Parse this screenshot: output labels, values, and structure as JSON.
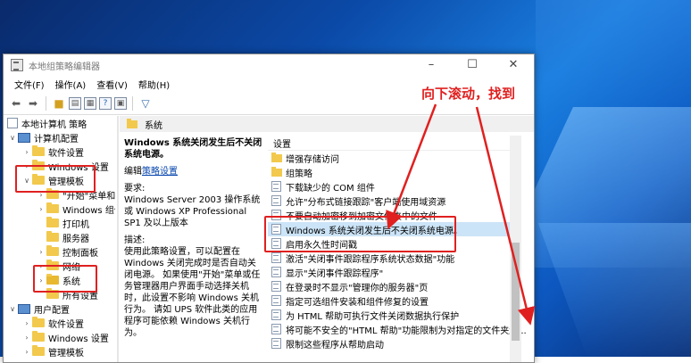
{
  "window": {
    "title": "本地组策略编辑器",
    "controls": [
      "–",
      "☐",
      "✕"
    ]
  },
  "menu": [
    "文件(F)",
    "操作(A)",
    "查看(V)",
    "帮助(H)"
  ],
  "tree": [
    {
      "label": "本地计算机 策略",
      "icon": "policy-icon"
    },
    {
      "label": "计算机配置",
      "icon": "computer-icon"
    },
    {
      "label": "软件设置",
      "icon": "folder-icon"
    },
    {
      "label": "Windows 设置",
      "icon": "folder-icon"
    },
    {
      "label": "管理模板",
      "icon": "folder-icon"
    },
    {
      "label": "\"开始\"菜单和",
      "icon": "folder-icon"
    },
    {
      "label": "Windows 组件",
      "icon": "folder-icon"
    },
    {
      "label": "打印机",
      "icon": "folder-icon"
    },
    {
      "label": "服务器",
      "icon": "folder-icon"
    },
    {
      "label": "控制面板",
      "icon": "folder-icon"
    },
    {
      "label": "网络",
      "icon": "folder-icon"
    },
    {
      "label": "系统",
      "icon": "folder-icon"
    },
    {
      "label": "所有设置",
      "icon": "folder-icon"
    },
    {
      "label": "用户配置",
      "icon": "computer-icon"
    },
    {
      "label": "软件设置",
      "icon": "folder-icon"
    },
    {
      "label": "Windows 设置",
      "icon": "folder-icon"
    },
    {
      "label": "管理模板",
      "icon": "folder-icon"
    }
  ],
  "header": {
    "title": "系统"
  },
  "description": {
    "title": "Windows 系统关闭发生后不关闭系统电源。",
    "edit_prefix": "编辑",
    "edit_link": "策略设置",
    "requirements_label": "要求:",
    "requirements_text": "Windows Server 2003 操作系统或 Windows XP Professional SP1 及以上版本",
    "desc_label": "描述:",
    "desc_text": "使用此策略设置，可以配置在 Windows 关闭完成时是否自动关闭电源。 如果使用\"开始\"菜单或任务管理器用户界面手动选择关机时，此设置不影响 Windows 关机行为。 请如 UPS 软件此类的应用程序可能依赖 Windows 关机行为。"
  },
  "list": {
    "column_header": "设置",
    "rows": [
      {
        "label": "增强存储访问",
        "type": "folder"
      },
      {
        "label": "组策略",
        "type": "folder"
      },
      {
        "label": "下载缺少的 COM 组件",
        "type": "setting"
      },
      {
        "label": "允许\"分布式链接跟踪\"客户端使用域资源",
        "type": "setting"
      },
      {
        "label": "不要自动加密移到加密文件夹中的文件",
        "type": "setting"
      },
      {
        "label": "Windows 系统关闭发生后不关闭系统电源。",
        "type": "setting"
      },
      {
        "label": "启用永久性时间戳",
        "type": "setting"
      },
      {
        "label": "激活\"关闭事件跟踪程序系统状态数据\"功能",
        "type": "setting"
      },
      {
        "label": "显示\"关闭事件跟踪程序\"",
        "type": "setting"
      },
      {
        "label": "在登录时不显示\"管理你的服务器\"页",
        "type": "setting"
      },
      {
        "label": "指定可选组件安装和组件修复的设置",
        "type": "setting"
      },
      {
        "label": "为 HTML 帮助可执行文件关闭数据执行保护",
        "type": "setting"
      },
      {
        "label": "将可能不安全的\"HTML 帮助\"功能限制为对指定的文件夹起...",
        "type": "setting"
      },
      {
        "label": "限制这些程序从帮助启动",
        "type": "setting"
      }
    ]
  },
  "annotation": {
    "text": "向下滚动，找到",
    "color": "#e02020"
  }
}
